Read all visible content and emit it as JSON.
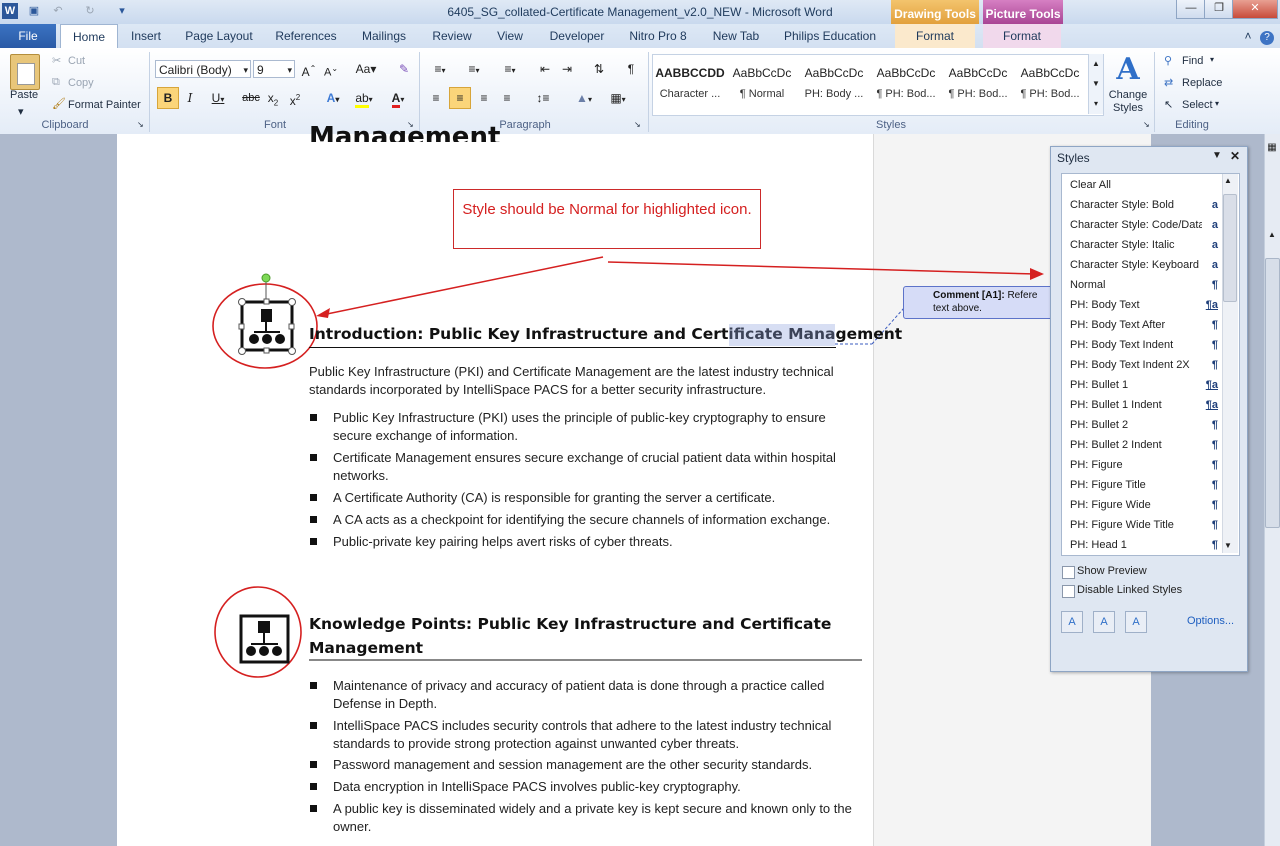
{
  "window": {
    "title": "6405_SG_collated-Certificate Management_v2.0_NEW  -  Microsoft Word",
    "contextual_tabs": [
      {
        "header": "Drawing Tools",
        "tab": "Format",
        "color": "#e8a33a"
      },
      {
        "header": "Picture Tools",
        "tab": "Format",
        "color": "#b04a9c"
      }
    ]
  },
  "tabs": [
    "File",
    "Home",
    "Insert",
    "Page Layout",
    "References",
    "Mailings",
    "Review",
    "View",
    "Developer",
    "Nitro Pro 8",
    "New Tab",
    "Philips Education"
  ],
  "ribbon": {
    "clipboard": {
      "paste": "Paste",
      "cut": "Cut",
      "copy": "Copy",
      "format_painter": "Format Painter",
      "label": "Clipboard"
    },
    "font": {
      "family": "Calibri (Body)",
      "size": "9",
      "label": "Font"
    },
    "paragraph": {
      "label": "Paragraph"
    },
    "styles": {
      "label": "Styles",
      "gallery": [
        {
          "preview": "AABBCCDD",
          "name": "Character ..."
        },
        {
          "preview": "AaBbCcDc",
          "name": "¶ Normal"
        },
        {
          "preview": "AaBbCcDc",
          "name": "PH: Body ..."
        },
        {
          "preview": "AaBbCcDc",
          "name": "¶ PH: Bod..."
        },
        {
          "preview": "AaBbCcDc",
          "name": "¶ PH: Bod..."
        },
        {
          "preview": "AaBbCcDc",
          "name": "¶ PH: Bod..."
        }
      ],
      "change_styles": "Change Styles"
    },
    "editing": {
      "find": "Find",
      "replace": "Replace",
      "select": "Select",
      "label": "Editing"
    }
  },
  "document": {
    "cut_heading": "Management",
    "annotation": "Style should be Normal for highlighted icon.",
    "heading1": "Introduction: Public Key Infrastructure and Certificate Management",
    "intro": "Public Key Infrastructure (PKI) and Certificate Management are the latest industry technical standards incorporated by IntelliSpace PACS for a better security infrastructure.",
    "bullets1": [
      "Public Key Infrastructure (PKI) uses the principle of public-key cryptography to ensure secure exchange of information.",
      "Certificate Management ensures secure exchange of crucial patient data within hospital networks.",
      "A Certificate Authority (CA) is responsible for granting the server a certificate.",
      "A CA acts as a checkpoint for identifying the secure channels of information exchange.",
      "Public-private key pairing helps avert risks of cyber threats."
    ],
    "heading2_line1": "Knowledge Points: Public Key Infrastructure and Certificate",
    "heading2_line2": "Management",
    "bullets2": [
      "Maintenance of privacy and accuracy of patient data is done through a practice called Defense in Depth.",
      "IntelliSpace PACS includes security controls that adhere to the latest industry technical standards to provide strong protection against unwanted cyber threats.",
      "Password management and session management are the other security standards.",
      "Data encryption in IntelliSpace PACS involves public-key cryptography.",
      "A public key is disseminated widely and a private key is kept secure and known only to the owner."
    ],
    "comment": {
      "label": "Comment [A1]:",
      "text": "Refere",
      "text2": "text above."
    }
  },
  "styles_pane": {
    "title": "Styles",
    "items": [
      {
        "name": "Clear All",
        "mark": ""
      },
      {
        "name": "Character Style: Bold",
        "mark": "a"
      },
      {
        "name": "Character Style: Code/Data",
        "mark": "a"
      },
      {
        "name": "Character Style: Italic",
        "mark": "a"
      },
      {
        "name": "Character Style: Keyboard",
        "mark": "a"
      },
      {
        "name": "Normal",
        "mark": "¶"
      },
      {
        "name": "PH: Body Text",
        "mark": "¶a"
      },
      {
        "name": "PH: Body Text After",
        "mark": "¶"
      },
      {
        "name": "PH: Body Text Indent",
        "mark": "¶"
      },
      {
        "name": "PH: Body Text Indent 2X",
        "mark": "¶"
      },
      {
        "name": "PH: Bullet 1",
        "mark": "¶a"
      },
      {
        "name": "PH: Bullet 1 Indent",
        "mark": "¶a"
      },
      {
        "name": "PH: Bullet 2",
        "mark": "¶"
      },
      {
        "name": "PH: Bullet 2 Indent",
        "mark": "¶"
      },
      {
        "name": "PH: Figure",
        "mark": "¶"
      },
      {
        "name": "PH: Figure Title",
        "mark": "¶"
      },
      {
        "name": "PH: Figure Wide",
        "mark": "¶"
      },
      {
        "name": "PH: Figure Wide Title",
        "mark": "¶"
      },
      {
        "name": "PH: Head 1",
        "mark": "¶"
      }
    ],
    "show_preview": "Show Preview",
    "disable_linked": "Disable Linked Styles",
    "options": "Options..."
  }
}
